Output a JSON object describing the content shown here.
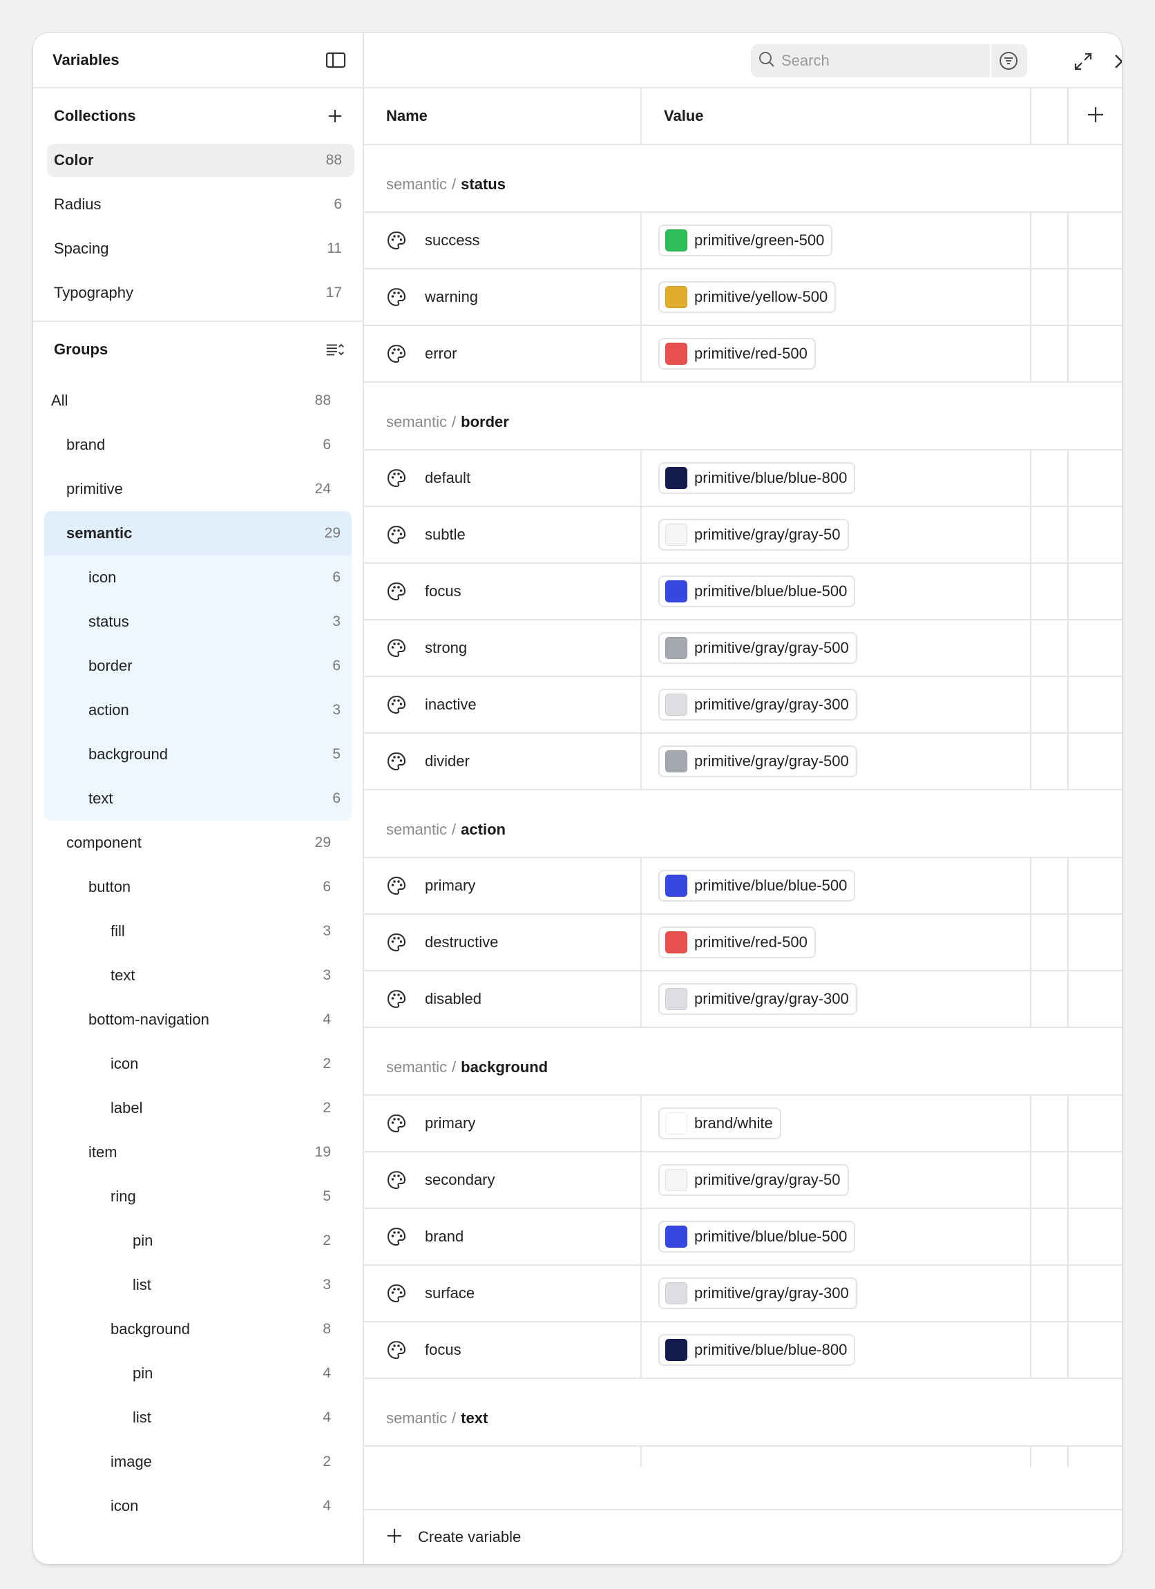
{
  "sidebar": {
    "title": "Variables",
    "collections_title": "Collections",
    "collections": [
      {
        "label": "Color",
        "count": "88"
      },
      {
        "label": "Radius",
        "count": "6"
      },
      {
        "label": "Spacing",
        "count": "11"
      },
      {
        "label": "Typography",
        "count": "17"
      }
    ],
    "groups_title": "Groups",
    "groups": [
      {
        "label": "All",
        "count": "88"
      },
      {
        "label": "brand",
        "count": "6"
      },
      {
        "label": "primitive",
        "count": "24"
      },
      {
        "label": "semantic",
        "count": "29"
      },
      {
        "label": "icon",
        "count": "6"
      },
      {
        "label": "status",
        "count": "3"
      },
      {
        "label": "border",
        "count": "6"
      },
      {
        "label": "action",
        "count": "3"
      },
      {
        "label": "background",
        "count": "5"
      },
      {
        "label": "text",
        "count": "6"
      },
      {
        "label": "component",
        "count": "29"
      },
      {
        "label": "button",
        "count": "6"
      },
      {
        "label": "fill",
        "count": "3"
      },
      {
        "label": "text",
        "count": "3"
      },
      {
        "label": "bottom-navigation",
        "count": "4"
      },
      {
        "label": "icon",
        "count": "2"
      },
      {
        "label": "label",
        "count": "2"
      },
      {
        "label": "item",
        "count": "19"
      },
      {
        "label": "ring",
        "count": "5"
      },
      {
        "label": "pin",
        "count": "2"
      },
      {
        "label": "list",
        "count": "3"
      },
      {
        "label": "background",
        "count": "8"
      },
      {
        "label": "pin",
        "count": "4"
      },
      {
        "label": "list",
        "count": "4"
      },
      {
        "label": "image",
        "count": "2"
      },
      {
        "label": "icon",
        "count": "4"
      }
    ]
  },
  "toolbar": {
    "search_placeholder": "Search"
  },
  "table": {
    "columns": {
      "name": "Name",
      "value": "Value"
    },
    "groups": [
      {
        "prefix": "semantic",
        "separator": "/",
        "name": "status",
        "rows": [
          {
            "name": "success",
            "value": "primitive/green-500",
            "color": "#2dbd5a"
          },
          {
            "name": "warning",
            "value": "primitive/yellow-500",
            "color": "#e2ac2c"
          },
          {
            "name": "error",
            "value": "primitive/red-500",
            "color": "#e85050"
          }
        ]
      },
      {
        "prefix": "semantic",
        "separator": "/",
        "name": "border",
        "rows": [
          {
            "name": "default",
            "value": "primitive/blue/blue-800",
            "color": "#141b4f"
          },
          {
            "name": "subtle",
            "value": "primitive/gray/gray-50",
            "color": "#f4f5f7"
          },
          {
            "name": "focus",
            "value": "primitive/blue/blue-500",
            "color": "#3748e0"
          },
          {
            "name": "strong",
            "value": "primitive/gray/gray-500",
            "color": "#a4a9b0"
          },
          {
            "name": "inactive",
            "value": "primitive/gray/gray-300",
            "color": "#dcdee2"
          },
          {
            "name": "divider",
            "value": "primitive/gray/gray-500",
            "color": "#a4a9b0"
          }
        ]
      },
      {
        "prefix": "semantic",
        "separator": "/",
        "name": "action",
        "rows": [
          {
            "name": "primary",
            "value": "primitive/blue/blue-500",
            "color": "#3748e0"
          },
          {
            "name": "destructive",
            "value": "primitive/red-500",
            "color": "#e85050"
          },
          {
            "name": "disabled",
            "value": "primitive/gray/gray-300",
            "color": "#dcdee2"
          }
        ]
      },
      {
        "prefix": "semantic",
        "separator": "/",
        "name": "background",
        "rows": [
          {
            "name": "primary",
            "value": "brand/white",
            "color": "#ffffff"
          },
          {
            "name": "secondary",
            "value": "primitive/gray/gray-50",
            "color": "#f4f5f7"
          },
          {
            "name": "brand",
            "value": "primitive/blue/blue-500",
            "color": "#3748e0"
          },
          {
            "name": "surface",
            "value": "primitive/gray/gray-300",
            "color": "#dcdee2"
          },
          {
            "name": "focus",
            "value": "primitive/blue/blue-800",
            "color": "#141b4f"
          }
        ]
      },
      {
        "prefix": "semantic",
        "separator": "/",
        "name": "text",
        "rows": []
      }
    ]
  },
  "footer": {
    "create_label": "Create variable"
  }
}
